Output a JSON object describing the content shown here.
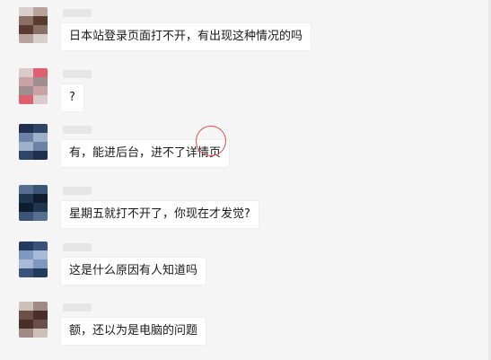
{
  "messages": [
    {
      "text": "日本站登录页面打不开，有出现这种情况的吗",
      "avatar_colors": [
        "#8a6f66",
        "#b6a39c",
        "#5b3a31",
        "#d6cfcb"
      ]
    },
    {
      "text": "?",
      "avatar_colors": [
        "#c9a2a6",
        "#e06070",
        "#9f8d8f",
        "#d9cacc"
      ]
    },
    {
      "text": "有，能进后台，进不了详情页",
      "avatar_colors": [
        "#6c83a8",
        "#2f4568",
        "#9eb0cc",
        "#1f2f4d"
      ]
    },
    {
      "text": "星期五就打不开了，你现在才发觉?",
      "avatar_colors": [
        "#1f3550",
        "#3a5578",
        "#0f1d2e",
        "#566e90"
      ]
    },
    {
      "text": "这是什么原因有人知道吗",
      "avatar_colors": [
        "#7f98bf",
        "#3a527a",
        "#a9bad6",
        "#243a5f"
      ]
    },
    {
      "text": "额，还以为是电脑的问题",
      "avatar_colors": [
        "#6b5049",
        "#a08b84",
        "#4a2f28",
        "#cdbfba"
      ]
    }
  ]
}
